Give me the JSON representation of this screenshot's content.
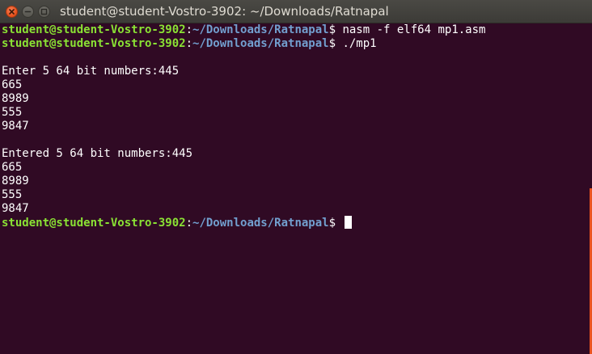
{
  "window": {
    "title": "student@student-Vostro-3902: ~/Downloads/Ratnapal"
  },
  "terminal": {
    "prompt_user_host": "student@student-Vostro-3902",
    "prompt_separator": ":",
    "prompt_path": "~/Downloads/Ratnapal",
    "prompt_symbol": "$ ",
    "commands": [
      "nasm -f elf64 mp1.asm",
      "./mp1"
    ],
    "output_lines": [
      "",
      "Enter 5 64 bit numbers:445",
      "665",
      "8989",
      "555",
      "9847",
      "",
      "Entered 5 64 bit numbers:445",
      "665",
      "8989",
      "555",
      "9847"
    ]
  },
  "colors": {
    "background": "#300a24",
    "prompt_user": "#8ae234",
    "prompt_path": "#729fcf",
    "close_button": "#e95420"
  }
}
